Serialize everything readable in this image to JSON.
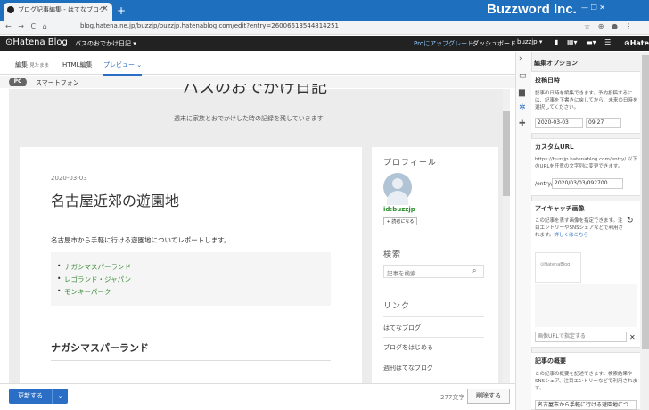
{
  "browser": {
    "tab_title": "ブログ記事編集 - はてなブログ",
    "close_glyph": "×",
    "new_tab_glyph": "+",
    "brand_overlay": "Buzzword Inc.",
    "window_controls": "—   ❐   ✕",
    "nav_glyphs": "← → C ⌂",
    "url": "blog.hatena.ne.jp/buzzjp/buzzjp.hatenablog.com/edit?entry=26006613544814251",
    "addr_right_glyphs": "☆ ⊕ ● ⋮"
  },
  "hatena_bar": {
    "logo": "⊙Hatena Blog",
    "blog_name": "バスのおでかけ日記 ▾",
    "pro": "Proにアップグレード",
    "dashboard": "ダッシュボード",
    "user": "buzzjp ▾",
    "icons": "▮ ▦▾ ▬▾ ☰",
    "hatena": "⊙Hatena"
  },
  "editor_tabs": {
    "edit": "編集",
    "edit_sub": "見たまま",
    "html": "HTML編集",
    "preview": "プレビュー ⌄"
  },
  "device": {
    "pc": "PC",
    "smartphone": "スマートフォン"
  },
  "blog": {
    "title": "バスのおでかけ日記",
    "description": "週末に家族とおでかけした時の記録を残していきます"
  },
  "article": {
    "date": "2020-03-03",
    "title": "名古屋近郊の遊園地",
    "intro": "名古屋市から手軽に行ける遊園地についてレポートします。",
    "list": [
      "ナガシマスパーランド",
      "レゴランド・ジャパン",
      "モンキーパーク"
    ],
    "heading": "ナガシマスパーランド"
  },
  "sidebar": {
    "profile_heading": "プロフィール",
    "profile_id": "id:buzzjp",
    "reader_button": "+ 読者になる",
    "search_heading": "検索",
    "search_placeholder": "記事を検索",
    "search_icon": "⌕",
    "links_heading": "リンク",
    "links": [
      "はてなブログ",
      "ブログをはじめる",
      "週刊はてなブログ"
    ]
  },
  "bottom": {
    "update": "更新する",
    "update_dd": "⌄",
    "char_count": "277文字",
    "delete": "削除する"
  },
  "strip_icons": {
    "collapse": "›",
    "comment": "▭",
    "folder": "▆",
    "gear": "✲",
    "plus": "✚"
  },
  "options": {
    "title": "編集オプション",
    "post_date": {
      "heading": "投稿日時",
      "text": "記事の日時を編集できます。予約投稿するには、記事を下書きに戻してから、未来の日時を選択してください。",
      "date": "2020-03-03",
      "time": "09:27"
    },
    "custom_url": {
      "heading": "カスタムURL",
      "text": "https://buzzjp.hatenablog.com/entry/ 以下のURLを任意の文字列に変更できます。",
      "prefix": "/entry/",
      "value": "2020/03/03/092700"
    },
    "eyecatch": {
      "heading": "アイキャッチ画像",
      "text": "この記事を表す画像を指定できます。注目エントリーやSNSシェアなどで利用されます。",
      "more": "詳しくはこちら",
      "logo": "⊙HatenaBlog",
      "refresh": "↻",
      "url_placeholder": "画像URLで指定する",
      "clear": "✕"
    },
    "summary": {
      "heading": "記事の概要",
      "text": "この記事の概要を記述できます。検索結果やSNSシェア、注目エントリーなどで利用されます。",
      "value": "名古屋市から手軽に行ける遊園地につ"
    }
  }
}
